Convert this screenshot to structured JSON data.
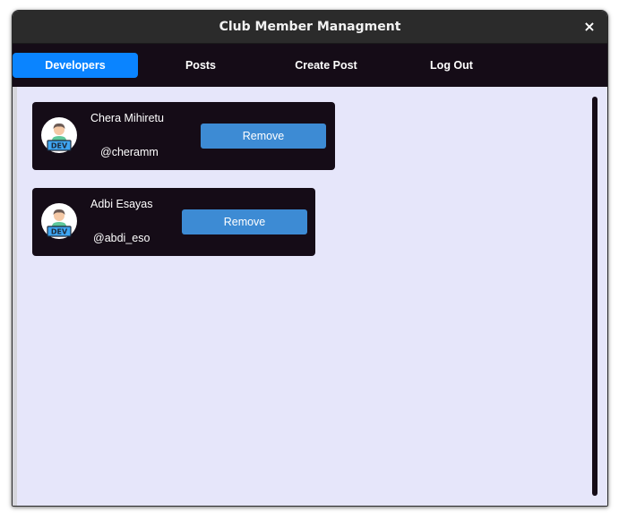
{
  "window": {
    "title": "Club Member Managment",
    "close_label": "×"
  },
  "nav": {
    "items": [
      {
        "label": "Developers",
        "active": true
      },
      {
        "label": "Posts",
        "active": false
      },
      {
        "label": "Create Post",
        "active": false
      },
      {
        "label": "Log Out",
        "active": false
      }
    ]
  },
  "members": [
    {
      "name": "Chera Mihiretu",
      "handle": "@cheramm",
      "avatar_badge": "DEV",
      "avatar_icon": "developer-avatar-icon",
      "action_label": "Remove"
    },
    {
      "name": "Adbi Esayas",
      "handle": "@abdi_eso",
      "avatar_badge": "DEV",
      "avatar_icon": "developer-avatar-icon",
      "action_label": "Remove"
    }
  ],
  "colors": {
    "titlebar": "#2b2b2b",
    "navbar": "#150c17",
    "active_tab": "#0a84ff",
    "content_bg": "#e6e6fa",
    "card_bg": "#150c17",
    "button": "#3d8bd4"
  }
}
